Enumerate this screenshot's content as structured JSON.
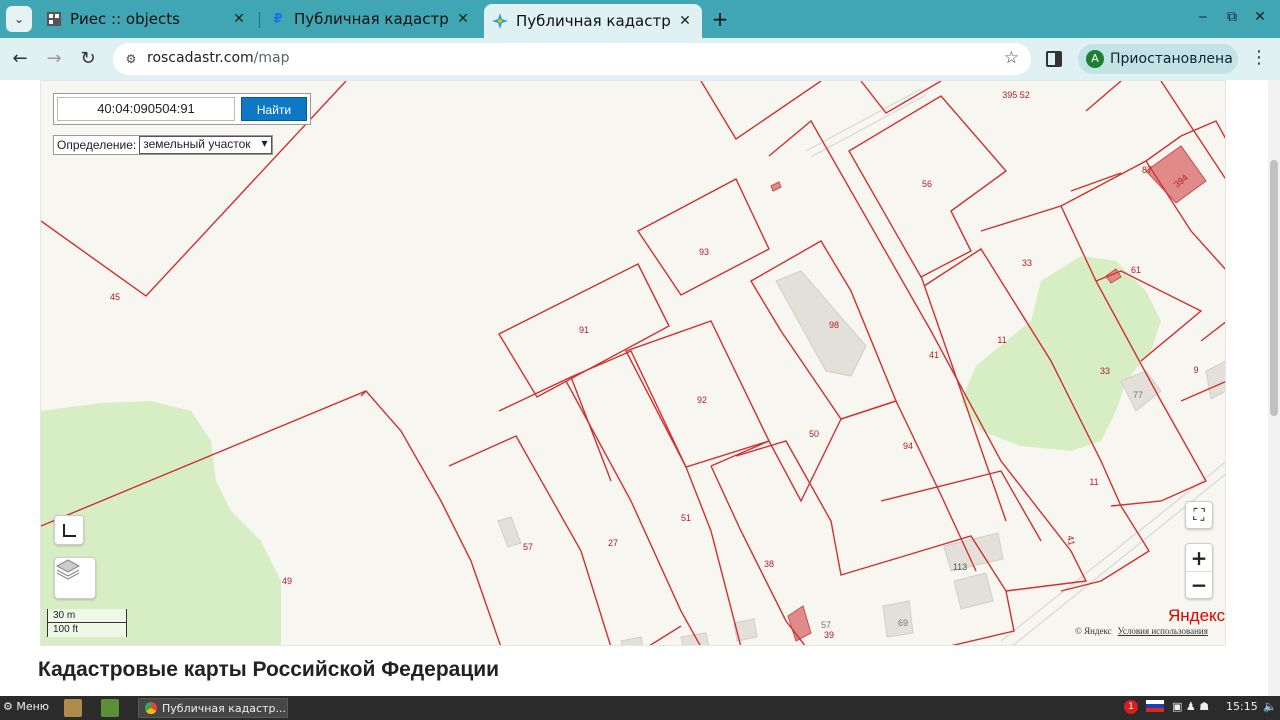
{
  "browser": {
    "tabs": [
      {
        "title": "Риес :: objects",
        "icon": "grid-favicon-icon"
      },
      {
        "title": "Публичная кадастр",
        "icon": "p-favicon-icon"
      },
      {
        "title": "Публичная кадастр",
        "icon": "star-favicon-icon",
        "active": true
      }
    ],
    "url_host": "roscadastr.com",
    "url_path": "/map",
    "profile_initial": "A",
    "profile_label": "Приостановлена"
  },
  "map": {
    "search_value": "40:04:090504:91",
    "search_button": "Найти",
    "definition_label": "Определение:",
    "definition_selected": "земельный участок",
    "scale_metric": "30 m",
    "scale_imperial": "100 ft",
    "provider": "Яндекс",
    "copyright": "© Яндекс",
    "terms": "Условия использования",
    "parcel_labels": [
      "395 52",
      "87",
      "394",
      "56",
      "93",
      "33",
      "61",
      "45",
      "91",
      "98",
      "41",
      "11",
      "33",
      "9",
      "92",
      "77",
      "50",
      "94",
      "11",
      "41",
      "51",
      "57",
      "27",
      "38",
      "113",
      "49",
      "69",
      "39",
      "57"
    ]
  },
  "page": {
    "heading": "Кадастровые карты Российской Федерации"
  },
  "taskbar": {
    "menu": "Меню",
    "task": "Публичная кадастр...",
    "time": "15:15",
    "badge": "1"
  }
}
